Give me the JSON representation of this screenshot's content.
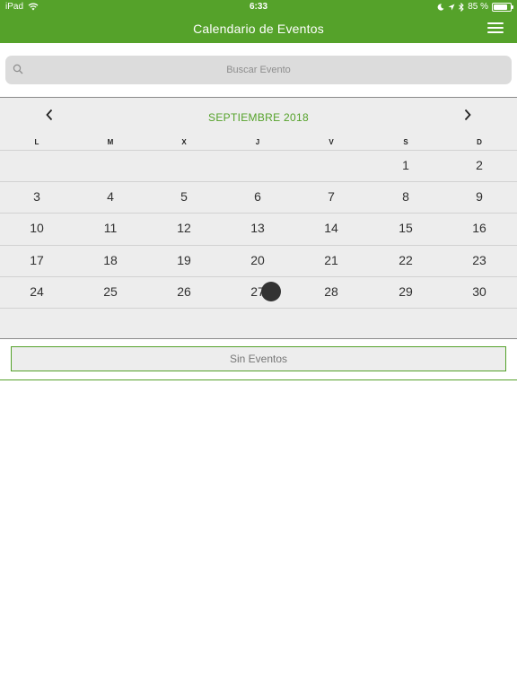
{
  "status_bar": {
    "device": "iPad",
    "time": "6:33",
    "battery": "85 %",
    "battery_level_percent": 85
  },
  "header": {
    "title": "Calendario de Eventos",
    "menu_icon": "hamburger-menu-icon"
  },
  "search": {
    "placeholder": "Buscar Evento",
    "icon": "search-icon"
  },
  "calendar": {
    "month_title": "SEPTIEMBRE 2018",
    "prev_icon": "chevron-left-icon",
    "next_icon": "chevron-right-icon",
    "weekdays": [
      "L",
      "M",
      "X",
      "J",
      "V",
      "S",
      "D"
    ],
    "weeks": [
      [
        "",
        "",
        "",
        "",
        "",
        "1",
        "2"
      ],
      [
        "3",
        "4",
        "5",
        "6",
        "7",
        "8",
        "9"
      ],
      [
        "10",
        "11",
        "12",
        "13",
        "14",
        "15",
        "16"
      ],
      [
        "17",
        "18",
        "19",
        "20",
        "21",
        "22",
        "23"
      ],
      [
        "24",
        "25",
        "26",
        "27",
        "28",
        "29",
        "30"
      ],
      [
        "",
        "",
        "",
        "",
        "",
        "",
        ""
      ]
    ],
    "today": "27",
    "today_marker_color": "#333333",
    "accent_color": "#55a22a"
  },
  "events": {
    "empty_label": "Sin Eventos"
  }
}
